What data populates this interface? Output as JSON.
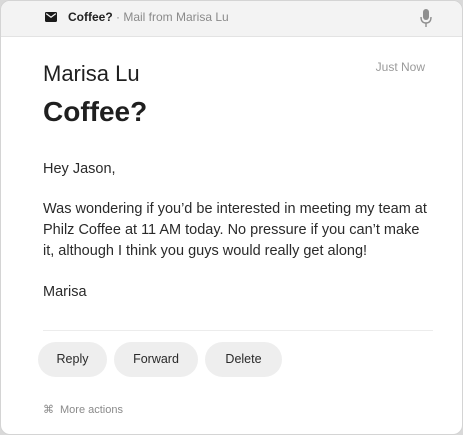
{
  "header": {
    "subject": "Coffee?",
    "separator": " · ",
    "source": "Mail from Marisa Lu",
    "mail_icon": "envelope-icon",
    "mic_icon": "microphone-icon"
  },
  "email": {
    "sender": "Marisa Lu",
    "timestamp": "Just Now",
    "subject": "Coffee?",
    "greeting": "Hey Jason,",
    "body": "Was wondering if you’d be interested in meeting my team at Philz Coffee at 11 AM today. No pressure if you can’t make it, although I think you guys would really get along!",
    "signature": "Marisa"
  },
  "actions": {
    "reply_label": "Reply",
    "forward_label": "Forward",
    "delete_label": "Delete",
    "more_symbol": "⌘",
    "more_label": "More actions"
  }
}
